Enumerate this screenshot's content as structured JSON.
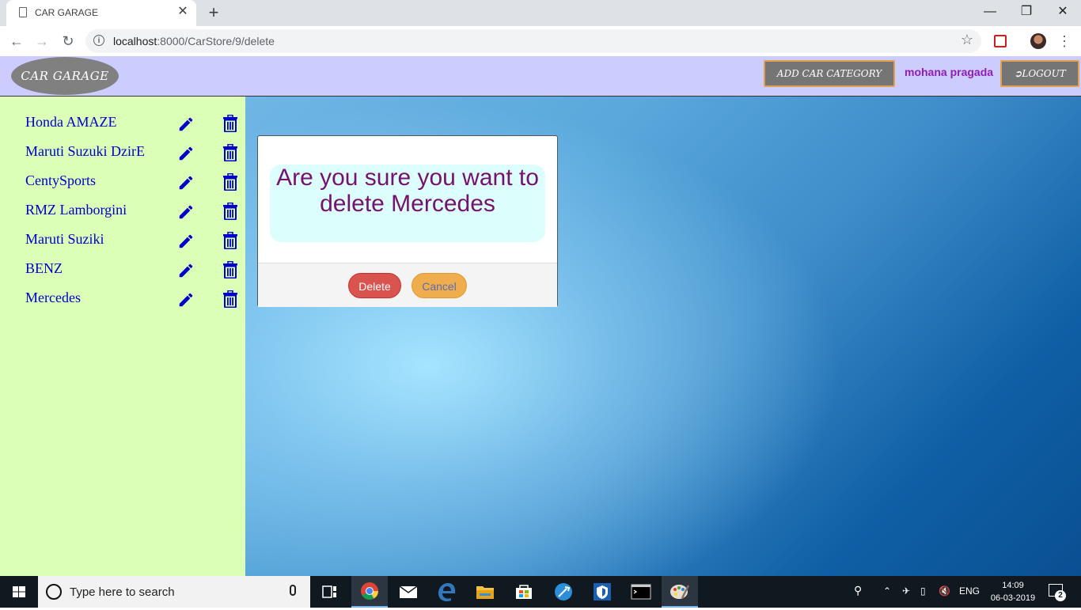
{
  "browser": {
    "tab_title": "CAR GARAGE",
    "tab_close": "✕",
    "new_tab": "+",
    "url_host": "localhost",
    "url_path": ":8000/CarStore/9/delete",
    "window_minimize": "—",
    "window_restore": "❐",
    "window_close": "✕"
  },
  "header": {
    "brand": "CAR GARAGE",
    "add_category_label": "ADD CAR CATEGORY",
    "username": "mohana pragada",
    "logout_label": "LOGOUT"
  },
  "sidebar": {
    "cars": [
      {
        "name": "Honda AMAZE"
      },
      {
        "name": "Maruti Suzuki DzirE"
      },
      {
        "name": "CentySports"
      },
      {
        "name": "RMZ Lamborgini"
      },
      {
        "name": "Maruti Suziki"
      },
      {
        "name": "BENZ"
      },
      {
        "name": "Mercedes"
      }
    ]
  },
  "modal": {
    "message": "Are you sure you want to delete Mercedes",
    "delete_label": "Delete",
    "cancel_label": "Cancel"
  },
  "colors": {
    "header_bg": "#ccccff",
    "sidebar_bg": "#dbffb6",
    "link_color": "#0000cc",
    "message_color": "#77106e",
    "delete_color": "#d9534f",
    "cancel_color": "#f0ad4e"
  },
  "taskbar": {
    "search_placeholder": "Type here to search",
    "language": "ENG",
    "time": "14:09",
    "date": "06-03-2019",
    "notification_count": "2"
  }
}
